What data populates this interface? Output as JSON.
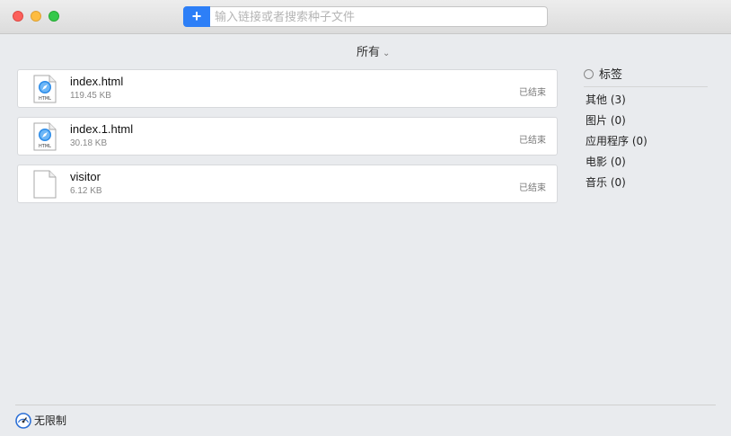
{
  "toolbar": {
    "add_label": "+",
    "search_placeholder": "输入链接或者搜索种子文件",
    "search_value": ""
  },
  "filter": {
    "label": "所有"
  },
  "files": [
    {
      "name": "index.html",
      "size": "119.45 KB",
      "status": "已结束",
      "icon": "html-file-icon"
    },
    {
      "name": "index.1.html",
      "size": "30.18 KB",
      "status": "已结束",
      "icon": "html-file-icon"
    },
    {
      "name": "visitor",
      "size": "6.12 KB",
      "status": "已结束",
      "icon": "generic-file-icon"
    }
  ],
  "sidebar": {
    "tags_label": "标签",
    "categories": [
      {
        "label": "其他 (3)"
      },
      {
        "label": "图片 (0)"
      },
      {
        "label": "应用程序 (0)"
      },
      {
        "label": "电影 (0)"
      },
      {
        "label": "音乐 (0)"
      }
    ]
  },
  "footer": {
    "speed_label": "无限制"
  },
  "colors": {
    "accent": "#2d7ff7",
    "background": "#e9ebee",
    "close": "#fc605b",
    "minimize": "#fdbc40",
    "maximize": "#34c84a"
  }
}
